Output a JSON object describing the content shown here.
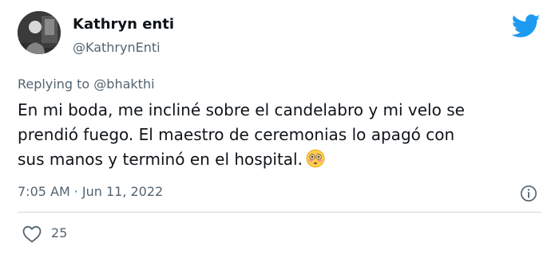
{
  "author": {
    "name": "Kathryn enti",
    "handle": "@KathrynEnti",
    "avatar_icon": "profile-photo"
  },
  "reply": {
    "prefix": "Replying to",
    "to": "@bhakthi"
  },
  "body": {
    "lines": [
      "En mi boda, me incliné sobre el candelabro y mi velo se",
      "prendió fuego. El maestro de ceremonias lo apagó con",
      "sus manos y terminó en el hospital."
    ],
    "emoji": "flushed-face-emoji"
  },
  "meta": {
    "time": "7:05 AM",
    "separator": "·",
    "date": "Jun 11, 2022"
  },
  "actions": {
    "likes": "25"
  },
  "colors": {
    "accent": "#1d9bf0",
    "secondary_text": "#536471",
    "primary_text": "#0f1419",
    "divider": "#cfd9de"
  }
}
